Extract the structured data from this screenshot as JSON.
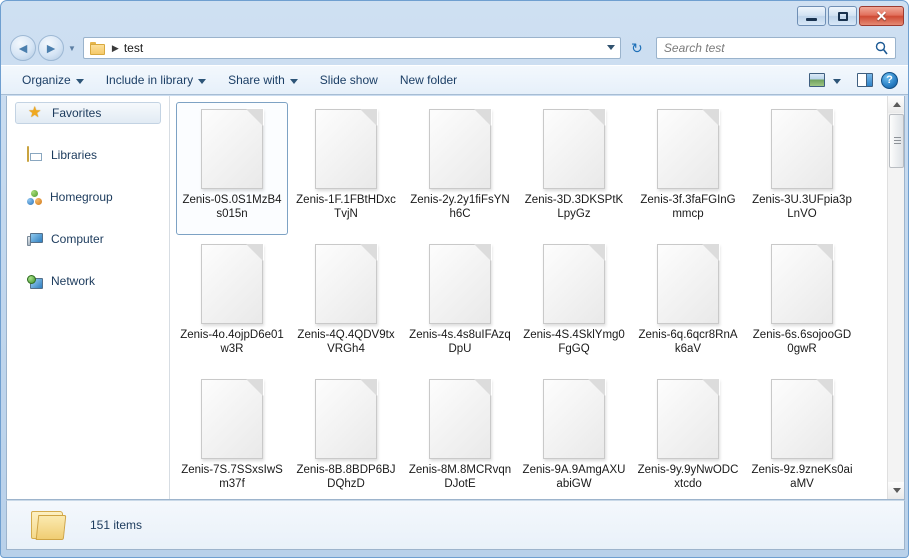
{
  "window": {
    "title": "",
    "buttons": {
      "minimize": "minimize-button",
      "maximize": "maximize-button",
      "close": "✕"
    }
  },
  "address_bar": {
    "back_glyph": "◄",
    "forward_glyph": "►",
    "crumb_separator": "▶",
    "path": "test",
    "refresh_glyph": "↻"
  },
  "search": {
    "placeholder": "Search test",
    "value": ""
  },
  "toolbar": {
    "items": [
      {
        "label": "Organize",
        "has_caret": true
      },
      {
        "label": "Include in library",
        "has_caret": true
      },
      {
        "label": "Share with",
        "has_caret": true
      },
      {
        "label": "Slide show",
        "has_caret": false
      },
      {
        "label": "New folder",
        "has_caret": false
      }
    ],
    "help_label": "?"
  },
  "sidebar": {
    "items": [
      {
        "label": "Favorites",
        "icon": "star-icon",
        "active": true
      },
      {
        "label": "Libraries",
        "icon": "library-icon",
        "active": false
      },
      {
        "label": "Homegroup",
        "icon": "homegroup-icon",
        "active": false
      },
      {
        "label": "Computer",
        "icon": "computer-icon",
        "active": false
      },
      {
        "label": "Network",
        "icon": "network-icon",
        "active": false
      }
    ]
  },
  "files": [
    {
      "name": "Zenis-0S.0S1MzB4s015n",
      "selected": true
    },
    {
      "name": "Zenis-1F.1FBtHDxcTvjN",
      "selected": false
    },
    {
      "name": "Zenis-2y.2y1fiFsYNh6C",
      "selected": false
    },
    {
      "name": "Zenis-3D.3DKSPtKLpyGz",
      "selected": false
    },
    {
      "name": "Zenis-3f.3faFGInGmmcp",
      "selected": false
    },
    {
      "name": "Zenis-3U.3UFpia3pLnVO",
      "selected": false
    },
    {
      "name": "Zenis-4o.4ojpD6e01w3R",
      "selected": false
    },
    {
      "name": "Zenis-4Q.4QDV9txVRGh4",
      "selected": false
    },
    {
      "name": "Zenis-4s.4s8uIFAzqDpU",
      "selected": false
    },
    {
      "name": "Zenis-4S.4SklYmg0FgGQ",
      "selected": false
    },
    {
      "name": "Zenis-6q.6qcr8RnAk6aV",
      "selected": false
    },
    {
      "name": "Zenis-6s.6sojooGD0gwR",
      "selected": false
    },
    {
      "name": "Zenis-7S.7SSxsIwSm37f",
      "selected": false
    },
    {
      "name": "Zenis-8B.8BDP6BJDQhzD",
      "selected": false
    },
    {
      "name": "Zenis-8M.8MCRvqnDJotE",
      "selected": false
    },
    {
      "name": "Zenis-9A.9AmgAXUabiGW",
      "selected": false
    },
    {
      "name": "Zenis-9y.9yNwODCxtcdo",
      "selected": false
    },
    {
      "name": "Zenis-9z.9zneKs0aiaMV",
      "selected": false
    }
  ],
  "status": {
    "item_count": "151 items"
  },
  "colors": {
    "frame": "#b9d1ea",
    "selection_border": "#7da2c4",
    "accent_text": "#1b3a5c",
    "close_button": "#cf4a34"
  }
}
